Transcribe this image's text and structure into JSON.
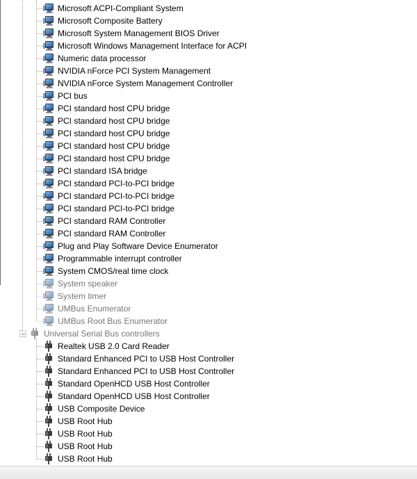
{
  "system_devices": [
    "Microsoft ACPI-Compliant System",
    "Microsoft Composite Battery",
    "Microsoft System Management BIOS Driver",
    "Microsoft Windows Management Interface for ACPI",
    "Numeric data processor",
    "NVIDIA nForce PCI System Management",
    "NVIDIA nForce System Management Controller",
    "PCI bus",
    "PCI standard host CPU bridge",
    "PCI standard host CPU bridge",
    "PCI standard host CPU bridge",
    "PCI standard host CPU bridge",
    "PCI standard host CPU bridge",
    "PCI standard ISA bridge",
    "PCI standard PCI-to-PCI bridge",
    "PCI standard PCI-to-PCI bridge",
    "PCI standard PCI-to-PCI bridge",
    "PCI standard RAM Controller",
    "PCI standard RAM Controller",
    "Plug and Play Software Device Enumerator",
    "Programmable interrupt controller",
    "System CMOS/real time clock",
    "System speaker",
    "System timer",
    "UMBus Enumerator",
    "UMBus Root Bus Enumerator"
  ],
  "usb_category": {
    "label": "Universal Serial Bus controllers",
    "devices": [
      "Realtek USB 2.0 Card Reader",
      "Standard Enhanced PCI to USB Host Controller",
      "Standard Enhanced PCI to USB Host Controller",
      "Standard OpenHCD USB Host Controller",
      "Standard OpenHCD USB Host Controller",
      "USB Composite Device",
      "USB Root Hub",
      "USB Root Hub",
      "USB Root Hub",
      "USB Root Hub"
    ]
  },
  "icons": {
    "system_device": "system-device-icon",
    "usb_device": "usb-plug-icon",
    "collapse": "collapse-minus-icon"
  }
}
